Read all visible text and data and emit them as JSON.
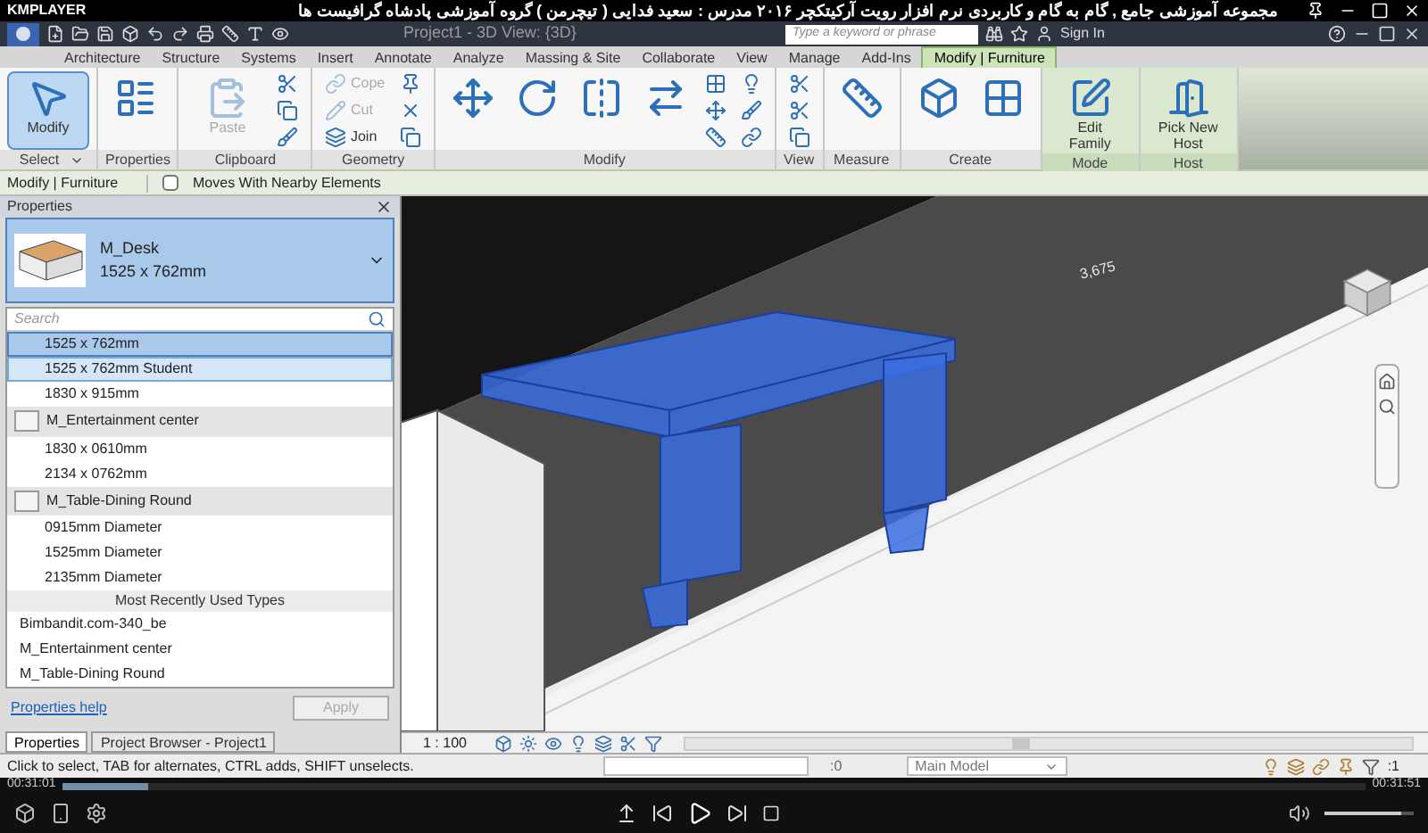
{
  "player": {
    "logo": "KMPLAYER",
    "title": "مجموعه آموزشی جامع , گام به گام و کاربردی نرم افزار رویت آرکیتکچر ۲۰۱۶   مدرس : سعید فدایی ( تیچرمن ) گروه آموزشی پادشاه گرافیست ها",
    "elapsed": "00:31:01",
    "total": "00:31:51",
    "progress": {
      "level": 0.065
    },
    "volume": {
      "level": 0.85
    }
  },
  "app": {
    "title": "Project1 - 3D View: {3D}",
    "search": {
      "placeholder": "Type a keyword or phrase"
    },
    "sign_in": "Sign In"
  },
  "tabs": [
    {
      "label": "Architecture",
      "selected": false
    },
    {
      "label": "Structure",
      "selected": false
    },
    {
      "label": "Systems",
      "selected": false
    },
    {
      "label": "Insert",
      "selected": false
    },
    {
      "label": "Annotate",
      "selected": false
    },
    {
      "label": "Analyze",
      "selected": false
    },
    {
      "label": "Massing & Site",
      "selected": false
    },
    {
      "label": "Collaborate",
      "selected": false
    },
    {
      "label": "View",
      "selected": false
    },
    {
      "label": "Manage",
      "selected": false
    },
    {
      "label": "Add-Ins",
      "selected": false
    },
    {
      "label": "Modify | Furniture",
      "selected": true
    }
  ],
  "ribbon": [
    {
      "label": "Select",
      "contextual": false,
      "dropdown": true,
      "buttons": [
        {
          "kind": "large",
          "label": "Modify",
          "selected": true,
          "disabled": false
        }
      ]
    },
    {
      "label": "Properties",
      "contextual": false,
      "dropdown": false,
      "buttons": [
        {
          "kind": "tool",
          "selected": false,
          "disabled": false
        }
      ]
    },
    {
      "label": "Clipboard",
      "contextual": false,
      "dropdown": false,
      "buttons": [
        {
          "kind": "large",
          "label": "Paste",
          "selected": false,
          "disabled": true
        },
        {
          "kind": "icon",
          "selected": false,
          "disabled": false
        },
        {
          "kind": "icon",
          "selected": false,
          "disabled": false
        },
        {
          "kind": "icon",
          "selected": false,
          "disabled": false
        }
      ]
    },
    {
      "label": "Geometry",
      "contextual": false,
      "dropdown": false,
      "buttons": [
        {
          "kind": "small",
          "label": "Cope",
          "selected": false,
          "disabled": true
        },
        {
          "kind": "small",
          "label": "Cut",
          "selected": false,
          "disabled": true
        },
        {
          "kind": "small",
          "label": "Join",
          "selected": false,
          "disabled": false
        },
        {
          "kind": "icon",
          "selected": false,
          "disabled": false
        },
        {
          "kind": "icon",
          "selected": false,
          "disabled": false
        },
        {
          "kind": "icon",
          "selected": false,
          "disabled": false
        }
      ]
    },
    {
      "label": "Modify",
      "contextual": false,
      "dropdown": false,
      "buttons": [
        {
          "kind": "tool",
          "selected": false,
          "disabled": false
        },
        {
          "kind": "tool",
          "selected": false,
          "disabled": false
        },
        {
          "kind": "tool",
          "selected": false,
          "disabled": false
        },
        {
          "kind": "tool",
          "selected": false,
          "disabled": false
        },
        {
          "kind": "icon",
          "selected": false,
          "disabled": false
        },
        {
          "kind": "icon",
          "selected": false,
          "disabled": false
        },
        {
          "kind": "icon",
          "selected": false,
          "disabled": false
        },
        {
          "kind": "icon",
          "selected": false,
          "disabled": false
        },
        {
          "kind": "icon",
          "selected": false,
          "disabled": false
        },
        {
          "kind": "icon",
          "selected": false,
          "disabled": false
        }
      ]
    },
    {
      "label": "View",
      "contextual": false,
      "dropdown": false,
      "buttons": [
        {
          "kind": "icon",
          "selected": false,
          "disabled": false
        },
        {
          "kind": "icon",
          "selected": false,
          "disabled": false
        },
        {
          "kind": "icon",
          "selected": false,
          "disabled": false
        }
      ]
    },
    {
      "label": "Measure",
      "contextual": false,
      "dropdown": false,
      "buttons": [
        {
          "kind": "tool",
          "selected": false,
          "disabled": false
        }
      ]
    },
    {
      "label": "Create",
      "contextual": false,
      "dropdown": false,
      "buttons": [
        {
          "kind": "tool",
          "selected": false,
          "disabled": false
        },
        {
          "kind": "tool",
          "selected": false,
          "disabled": false
        }
      ]
    },
    {
      "label": "Mode",
      "contextual": true,
      "dropdown": false,
      "buttons": [
        {
          "kind": "large",
          "label": "Edit Family",
          "selected": false,
          "disabled": false
        }
      ]
    },
    {
      "label": "Host",
      "contextual": true,
      "dropdown": false,
      "buttons": [
        {
          "kind": "large",
          "label": "Pick New Host",
          "selected": false,
          "disabled": false
        }
      ]
    }
  ],
  "options_bar": {
    "context": "Modify | Furniture",
    "checkbox": {
      "label": "Moves With Nearby Elements",
      "checked": false
    }
  },
  "properties": {
    "title": "Properties",
    "type": {
      "family": "M_Desk",
      "name": "1525 x 762mm"
    },
    "search": {
      "placeholder": "Search"
    },
    "list": [
      {
        "kind": "item",
        "label": "1525 x 762mm",
        "selected": true,
        "hover": false
      },
      {
        "kind": "item",
        "label": "1525 x 762mm Student",
        "selected": false,
        "hover": true
      },
      {
        "kind": "item",
        "label": "1830 x 915mm",
        "selected": false,
        "hover": false
      },
      {
        "kind": "group",
        "label": "M_Entertainment center"
      },
      {
        "kind": "item",
        "label": "1830 x 0610mm",
        "selected": false,
        "hover": false
      },
      {
        "kind": "item",
        "label": "2134 x 0762mm",
        "selected": false,
        "hover": false
      },
      {
        "kind": "group",
        "label": "M_Table-Dining Round"
      },
      {
        "kind": "item",
        "label": "0915mm Diameter",
        "selected": false,
        "hover": false
      },
      {
        "kind": "item",
        "label": "1525mm Diameter",
        "selected": false,
        "hover": false
      },
      {
        "kind": "item",
        "label": "2135mm Diameter",
        "selected": false,
        "hover": false
      },
      {
        "kind": "header",
        "label": "Most Recently Used Types"
      },
      {
        "kind": "recent",
        "label": "Bimbandit.com-340_be",
        "selected": false,
        "hover": false
      },
      {
        "kind": "recent",
        "label": "M_Entertainment center",
        "selected": false,
        "hover": false
      },
      {
        "kind": "recent",
        "label": "M_Table-Dining Round",
        "selected": false,
        "hover": false
      }
    ],
    "help": "Properties help",
    "apply": {
      "label": "Apply",
      "disabled": true
    },
    "tabs": [
      {
        "label": "Properties",
        "selected": true
      },
      {
        "label": "Project Browser - Project1",
        "selected": false
      }
    ]
  },
  "viewport": {
    "dimension": "3,675",
    "scale": "1 : 100"
  },
  "status_bar": {
    "message": "Click to select, TAB for alternates, CTRL adds, SHIFT unselects.",
    "selection_count": ":0",
    "model": "Main Model",
    "filter_count": ":1"
  }
}
